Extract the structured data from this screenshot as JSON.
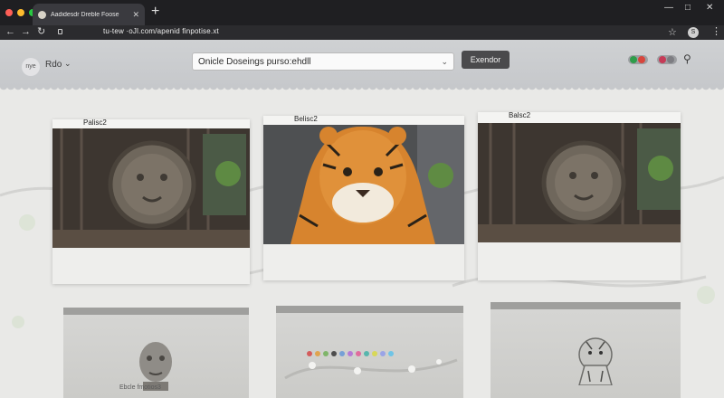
{
  "browser": {
    "tab_title": "Aadidesdr Dreble Foose",
    "url": "tu-tew ·oJl.com/apenid finpotise.xt",
    "window_controls": [
      "—",
      "□",
      "✕"
    ],
    "icons": {
      "back": "arrow-left-icon",
      "forward": "arrow-right-icon",
      "reload": "reload-icon",
      "lock": "lock-icon",
      "star": "star-icon",
      "extension": "extension-icon",
      "menu": "kebab-menu-icon"
    },
    "dot_colors": [
      "#ff5f57",
      "#febc2e",
      "#28c840"
    ],
    "extension_label": "S"
  },
  "header": {
    "avatar_initials": "nye",
    "user_name": "Rdo",
    "select_value": "Onicle Doseings purso:ehdll",
    "primary_button": "Exendor",
    "toggle_colors": [
      [
        "#2f9d4a",
        "#d8453c"
      ],
      [
        "#c63b57",
        "#7d7d82"
      ]
    ]
  },
  "cards": [
    {
      "label": "Palisc2",
      "image": "tiger-shield-relief"
    },
    {
      "label": "Belisc2",
      "image": "tiger-portrait"
    },
    {
      "label": "Balsc2",
      "image": "tiger-shield-relief"
    }
  ],
  "thumbs": [
    {
      "caption": "Ebcle fmotios3",
      "image": "stone-face-statue"
    },
    {
      "caption": "",
      "image": "blossom-panel"
    },
    {
      "caption": "",
      "image": "tiger-sketch"
    }
  ],
  "swatch_colors": [
    "#d35c5c",
    "#e0a44f",
    "#7fb56a",
    "#4d4d4d",
    "#76a0d6",
    "#b57ad6",
    "#e06b9d",
    "#58b6ad",
    "#d8d858",
    "#9aa4e6",
    "#6fc4e6"
  ],
  "accent": "#4a4a4c"
}
